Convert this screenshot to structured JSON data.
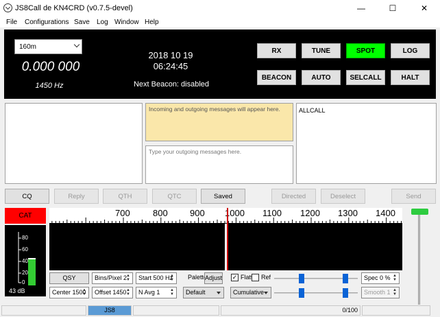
{
  "window": {
    "title": "JS8Call de KN4CRD (v0.7.5-devel)",
    "controls": {
      "minimize": "—",
      "maximize": "☐",
      "close": "✕"
    }
  },
  "menu": [
    "File",
    "Configurations",
    "Save",
    "Log",
    "Window",
    "Help"
  ],
  "header": {
    "band": "160m",
    "frequency": "0.000 000",
    "offset": "1450 Hz",
    "date": "2018 10 19",
    "time": "06:24:45",
    "next_beacon": "Next Beacon: disabled"
  },
  "control_buttons": [
    {
      "label": "RX",
      "active": false
    },
    {
      "label": "TUNE",
      "active": false
    },
    {
      "label": "SPOT",
      "active": true
    },
    {
      "label": "LOG",
      "active": false
    },
    {
      "label": "BEACON",
      "active": false
    },
    {
      "label": "AUTO",
      "active": false
    },
    {
      "label": "SELCALL",
      "active": false
    },
    {
      "label": "HALT",
      "active": false
    }
  ],
  "colors": {
    "active_button": "#00ff00",
    "cat_indicator": "#ff0000",
    "incoming_bg": "#fae7aa",
    "status_mode_bg": "#5b9bd5",
    "meter_bar": "#33cc33"
  },
  "messages": {
    "incoming_placeholder": "Incoming and outgoing messages will appear here.",
    "outgoing_placeholder": "Type your outgoing messages here.",
    "callsign_list": [
      "ALLCALL"
    ]
  },
  "action_buttons": [
    {
      "label": "CQ",
      "enabled": true
    },
    {
      "label": "Reply",
      "enabled": false
    },
    {
      "label": "QTH",
      "enabled": false
    },
    {
      "label": "QTC",
      "enabled": false
    },
    {
      "label": "Saved",
      "enabled": true
    },
    {
      "label": "Directed",
      "enabled": false
    },
    {
      "label": "Deselect",
      "enabled": false
    },
    {
      "label": "Send",
      "enabled": false
    }
  ],
  "cat": "CAT",
  "meter": {
    "ticks": [
      "80",
      "60",
      "40",
      "20",
      "0"
    ],
    "level_db": "43 dB",
    "level_fraction": 0.43
  },
  "waterfall": {
    "scale": [
      "700",
      "800",
      "900",
      "1000",
      "1100",
      "1200",
      "1300",
      "1400"
    ]
  },
  "wf_controls": {
    "qsy": "QSY",
    "bins_per_pixel": "Bins/Pixel  2",
    "start": "Start 500 Hz",
    "palette": "Palette",
    "adjust": "Adjust",
    "flatten": "Flatten",
    "flatten_checked": true,
    "ref_spec": "Ref Spec",
    "ref_checked": false,
    "spec": "Spec 0 %",
    "center": "Center 1500",
    "offset": "Offset 1450",
    "n_avg": "N Avg 1",
    "palette_select": "Default",
    "mode_select": "Cumulative",
    "smooth": "Smooth  1"
  },
  "status": {
    "mode": "JS8",
    "progress": "0/100"
  }
}
